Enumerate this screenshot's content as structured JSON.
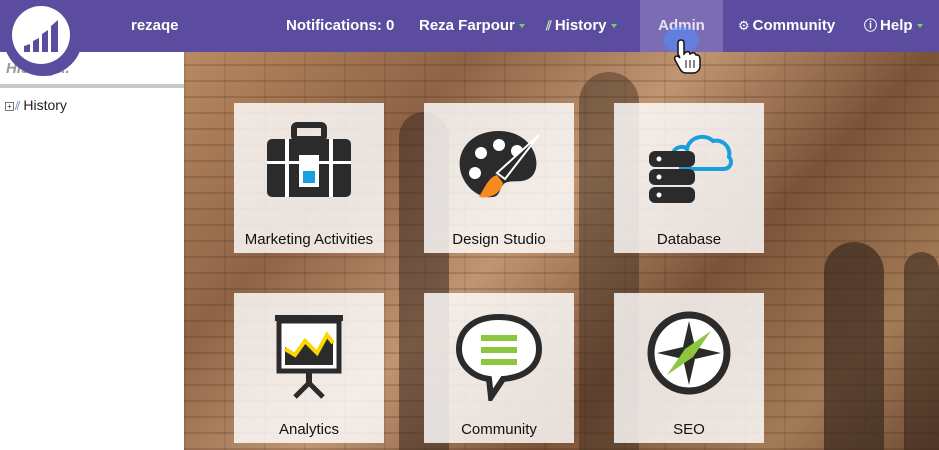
{
  "header": {
    "username": "rezaqe",
    "notifications_label": "Notifications: 0",
    "user_menu_label": "Reza Farpour",
    "history_label": "History",
    "admin_label": "Admin",
    "community_label": "Community",
    "help_label": "Help"
  },
  "sidebar": {
    "search": {
      "placeholder": "History..."
    },
    "tree": [
      {
        "label": "History",
        "expander": "+",
        "icon": "history-icon"
      }
    ]
  },
  "tiles": [
    {
      "label": "Marketing Activities",
      "icon": "briefcase-icon"
    },
    {
      "label": "Design Studio",
      "icon": "palette-brush-icon"
    },
    {
      "label": "Database",
      "icon": "database-cloud-icon"
    },
    {
      "label": "Analytics",
      "icon": "presentation-chart-icon"
    },
    {
      "label": "Community",
      "icon": "speech-bubble-icon"
    },
    {
      "label": "SEO",
      "icon": "compass-icon"
    }
  ],
  "colors": {
    "brand_purple": "#5c4c9f",
    "active_tab": "#7a6db3",
    "accent_blue": "#1a9fde",
    "accent_orange": "#f58a1f",
    "accent_green": "#8dc63f",
    "accent_yellow": "#ffd500",
    "icon_dark": "#2b2b2b"
  }
}
